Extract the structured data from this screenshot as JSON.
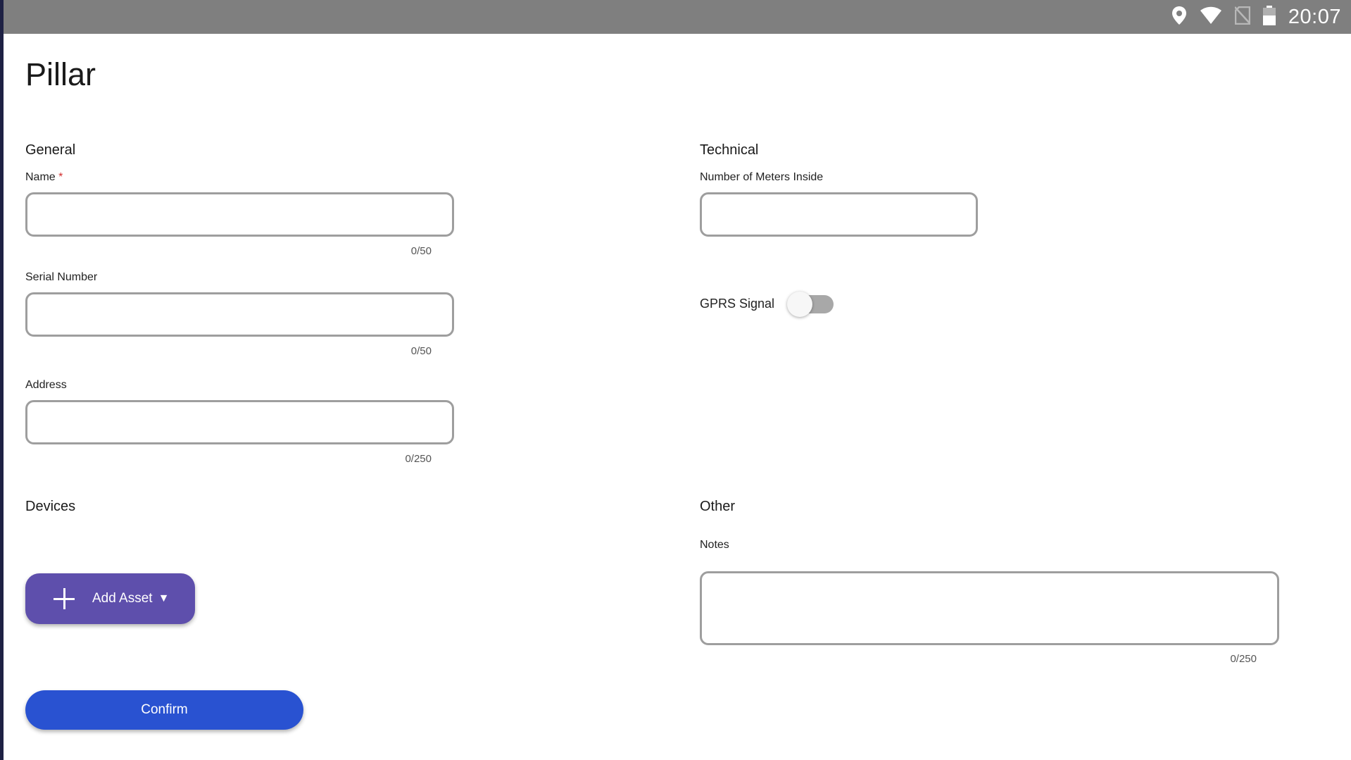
{
  "status_bar": {
    "time": "20:07",
    "icons": [
      "location-pin-icon",
      "wifi-icon",
      "no-sim-icon",
      "battery-icon"
    ]
  },
  "page": {
    "title": "Pillar"
  },
  "general": {
    "heading": "General",
    "name": {
      "label": "Name",
      "required_mark": "*",
      "value": "",
      "counter": "0/50"
    },
    "serial_number": {
      "label": "Serial Number",
      "value": "",
      "counter": "0/50"
    },
    "address": {
      "label": "Address",
      "value": "",
      "counter": "0/250"
    }
  },
  "technical": {
    "heading": "Technical",
    "meters": {
      "label": "Number of Meters Inside",
      "value": ""
    },
    "gprs": {
      "label": "GPRS Signal",
      "enabled": false
    }
  },
  "devices": {
    "heading": "Devices",
    "add_asset_label": "Add Asset",
    "add_asset_caret": "▼"
  },
  "other": {
    "heading": "Other",
    "notes": {
      "label": "Notes",
      "value": "",
      "counter": "0/250"
    }
  },
  "actions": {
    "confirm_label": "Confirm"
  },
  "colors": {
    "status_bar": "#7f7f7f",
    "add_asset": "#5e4fac",
    "confirm": "#2952d1",
    "required": "#d32f2f"
  }
}
